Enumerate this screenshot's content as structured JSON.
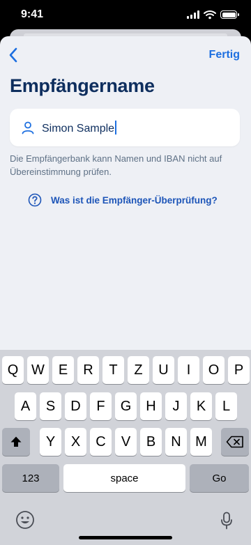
{
  "status_bar": {
    "time": "9:41"
  },
  "nav": {
    "done_label": "Fertig"
  },
  "page": {
    "title": "Empfängername"
  },
  "recipient_input": {
    "value": "Simon Sample",
    "icon": "person-icon"
  },
  "hint_text": "Die Empfängerbank kann Namen und IBAN nicht auf Übereinstimmung prüfen.",
  "help_link": {
    "label": "Was ist die Empfänger-Überprüfung?",
    "icon": "question-circle-icon"
  },
  "keyboard": {
    "row1": [
      "Q",
      "W",
      "E",
      "R",
      "T",
      "Z",
      "U",
      "I",
      "O",
      "P"
    ],
    "row2": [
      "A",
      "S",
      "D",
      "F",
      "G",
      "H",
      "J",
      "K",
      "L"
    ],
    "row3": [
      "Y",
      "X",
      "C",
      "V",
      "B",
      "N",
      "M"
    ],
    "numbers_label": "123",
    "space_label": "space",
    "go_label": "Go"
  },
  "colors": {
    "accent": "#1d6fe0",
    "title": "#0e2e5e",
    "link": "#1d55b8"
  }
}
